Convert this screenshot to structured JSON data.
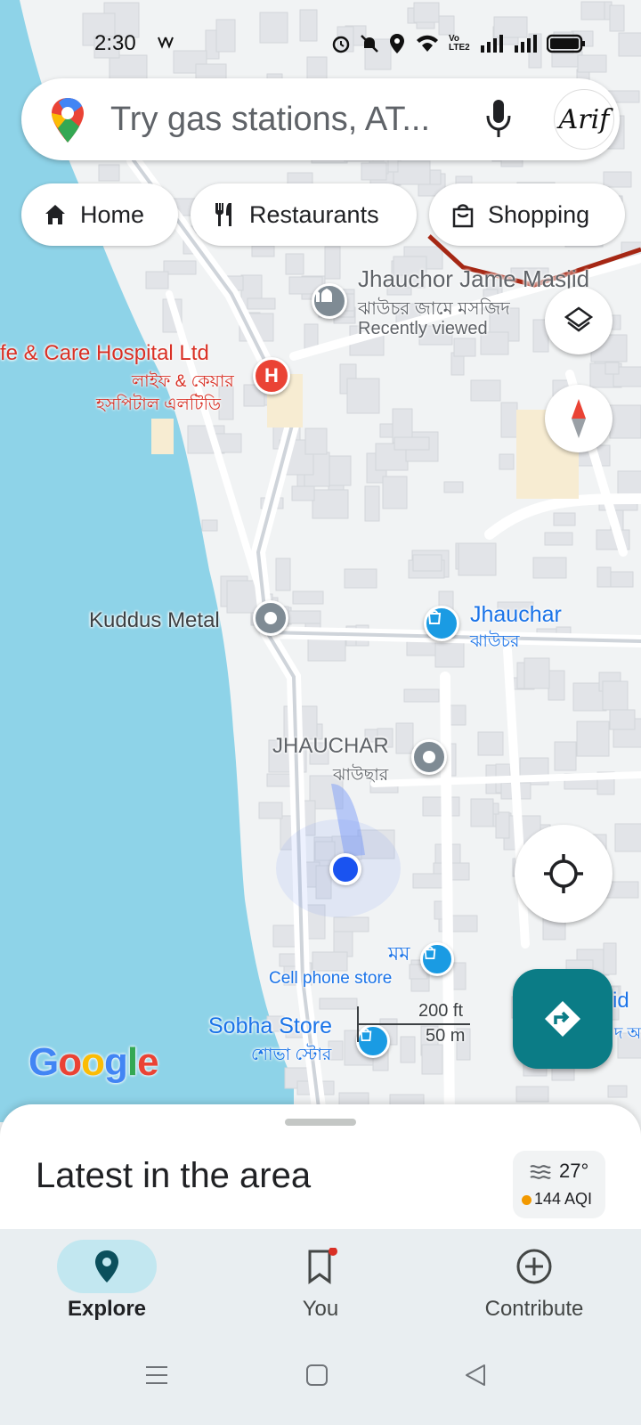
{
  "status_bar": {
    "time": "2:30",
    "volte": "Vo LTE2"
  },
  "search": {
    "placeholder": "Try gas stations, AT...",
    "avatar_text": "Arif"
  },
  "chips": [
    {
      "label": "Home",
      "icon": "home-icon"
    },
    {
      "label": "Restaurants",
      "icon": "restaurant-icon"
    },
    {
      "label": "Shopping",
      "icon": "shopping-bag-icon"
    }
  ],
  "map": {
    "places": {
      "masjid_name": "Jhauchor Jame Masjid",
      "masjid_bn": "ঝাউচর জামে মসজিদ",
      "masjid_note": "Recently viewed",
      "hospital_name": "fe & Care Hospital Ltd",
      "hospital_bn_1": "লাইফ & কেয়ার",
      "hospital_bn_2": "হসপিটাল এলটিডি",
      "kuddus": "Kuddus Metal",
      "jhauchar_shop": "Jhauchar",
      "jhauchar_shop_bn": "ঝাউচর",
      "jhauchar_area": "JHAUCHAR",
      "jhauchar_area_bn": "ঝাউছার",
      "momo_bn": "মম",
      "cell_store": "Cell phone store",
      "sobha": "Sobha Store",
      "sobha_bn": "শোভা স্টোর",
      "right_edge": "id",
      "right_edge_bn": "দ অ"
    },
    "scale": {
      "imperial": "200 ft",
      "metric": "50 m"
    },
    "logo": "Google"
  },
  "sheet": {
    "title": "Latest in the area",
    "weather": {
      "temp": "27°",
      "aqi": "144 AQI"
    }
  },
  "nav": [
    {
      "label": "Explore",
      "icon": "location-pin-icon",
      "active": true
    },
    {
      "label": "You",
      "icon": "bookmark-icon",
      "active": false
    },
    {
      "label": "Contribute",
      "icon": "add-circle-icon",
      "active": false
    }
  ],
  "colors": {
    "water": "#8ed3e8",
    "land": "#f1f3f4",
    "accent_teal": "#0b7c86",
    "location_blue": "#1a53f0",
    "active_pill": "#c2e7f0"
  }
}
